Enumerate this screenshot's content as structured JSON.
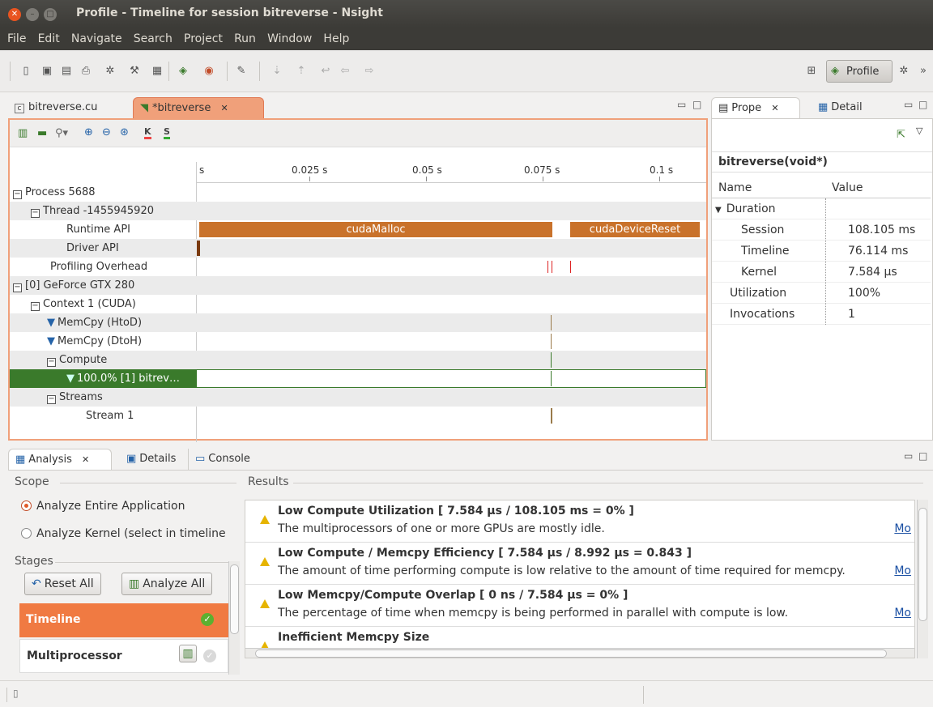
{
  "window": {
    "title": "Profile - Timeline for session bitreverse - Nsight"
  },
  "menu": [
    "File",
    "Edit",
    "Navigate",
    "Search",
    "Project",
    "Run",
    "Window",
    "Help"
  ],
  "toolbar": {
    "perspective_label": "Profile"
  },
  "editor": {
    "tabs": [
      {
        "label": "bitreverse.cu",
        "icon": "c-file-icon"
      },
      {
        "label": "*bitreverse",
        "icon": "profile-icon"
      }
    ],
    "ruler_labels": [
      "s",
      "0.025 s",
      "0.05 s",
      "0.075 s",
      "0.1 s"
    ],
    "rows": [
      {
        "label": "Process 5688",
        "expander": "−"
      },
      {
        "label": "Thread -1455945920",
        "expander": "−"
      },
      {
        "label": "Runtime API"
      },
      {
        "label": "Driver API"
      },
      {
        "label": "Profiling Overhead"
      },
      {
        "label": "[0] GeForce GTX 280",
        "expander": "−"
      },
      {
        "label": "Context 1 (CUDA)",
        "expander": "−"
      },
      {
        "label": "MemCpy (HtoD)"
      },
      {
        "label": "MemCpy (DtoH)"
      },
      {
        "label": "Compute",
        "expander": "−"
      },
      {
        "label": "100.0% [1] bitrev…"
      },
      {
        "label": "Streams",
        "expander": "−"
      },
      {
        "label": "Stream 1"
      }
    ],
    "bars": {
      "malloc_label": "cudaMalloc",
      "reset_label": "cudaDeviceReset"
    }
  },
  "properties": {
    "tabs": [
      {
        "label": "Prope"
      },
      {
        "label": "Detail"
      }
    ],
    "heading": "bitreverse(void*)",
    "col_name": "Name",
    "col_value": "Value",
    "rows": [
      {
        "name": "Duration",
        "value": ""
      },
      {
        "name": "Session",
        "value": "108.105 ms"
      },
      {
        "name": "Timeline",
        "value": "76.114 ms"
      },
      {
        "name": "Kernel",
        "value": "7.584 µs"
      },
      {
        "name": "Utilization",
        "value": "100%"
      },
      {
        "name": "Invocations",
        "value": "1"
      }
    ]
  },
  "bottom": {
    "tabs": [
      {
        "label": "Analysis"
      },
      {
        "label": "Details"
      },
      {
        "label": "Console"
      }
    ],
    "scope_title": "Scope",
    "scope_options": [
      "Analyze Entire Application",
      "Analyze Kernel (select in timeline"
    ],
    "stages_title": "Stages",
    "reset_all": "Reset All",
    "analyze_all": "Analyze All",
    "stages": [
      {
        "label": "Timeline",
        "active": true
      },
      {
        "label": "Multiprocessor",
        "active": false
      }
    ],
    "results_title": "Results",
    "results": [
      {
        "title": "Low Compute Utilization [ 7.584 µs / 108.105 ms = 0% ]",
        "desc": "The multiprocessors of one or more GPUs are mostly idle.",
        "more": "Mo"
      },
      {
        "title": "Low Compute / Memcpy Efficiency [ 7.584 µs / 8.992 µs = 0.843 ]",
        "desc": "The amount of time performing compute is low relative to the amount of time required for memcpy.",
        "more": "Mo"
      },
      {
        "title": "Low Memcpy/Compute Overlap [ 0 ns / 7.584 µs = 0% ]",
        "desc": "The percentage of time when memcpy is being performed in parallel with compute is low.",
        "more": "Mo"
      },
      {
        "title": "Inefficient Memcpy Size",
        "desc": "",
        "more": ""
      }
    ]
  },
  "colors": {
    "accent": "#f0a07a",
    "runtime_bar": "#c9722b",
    "selected_row": "#3a7a2b",
    "stage_active": "#f07a42"
  }
}
